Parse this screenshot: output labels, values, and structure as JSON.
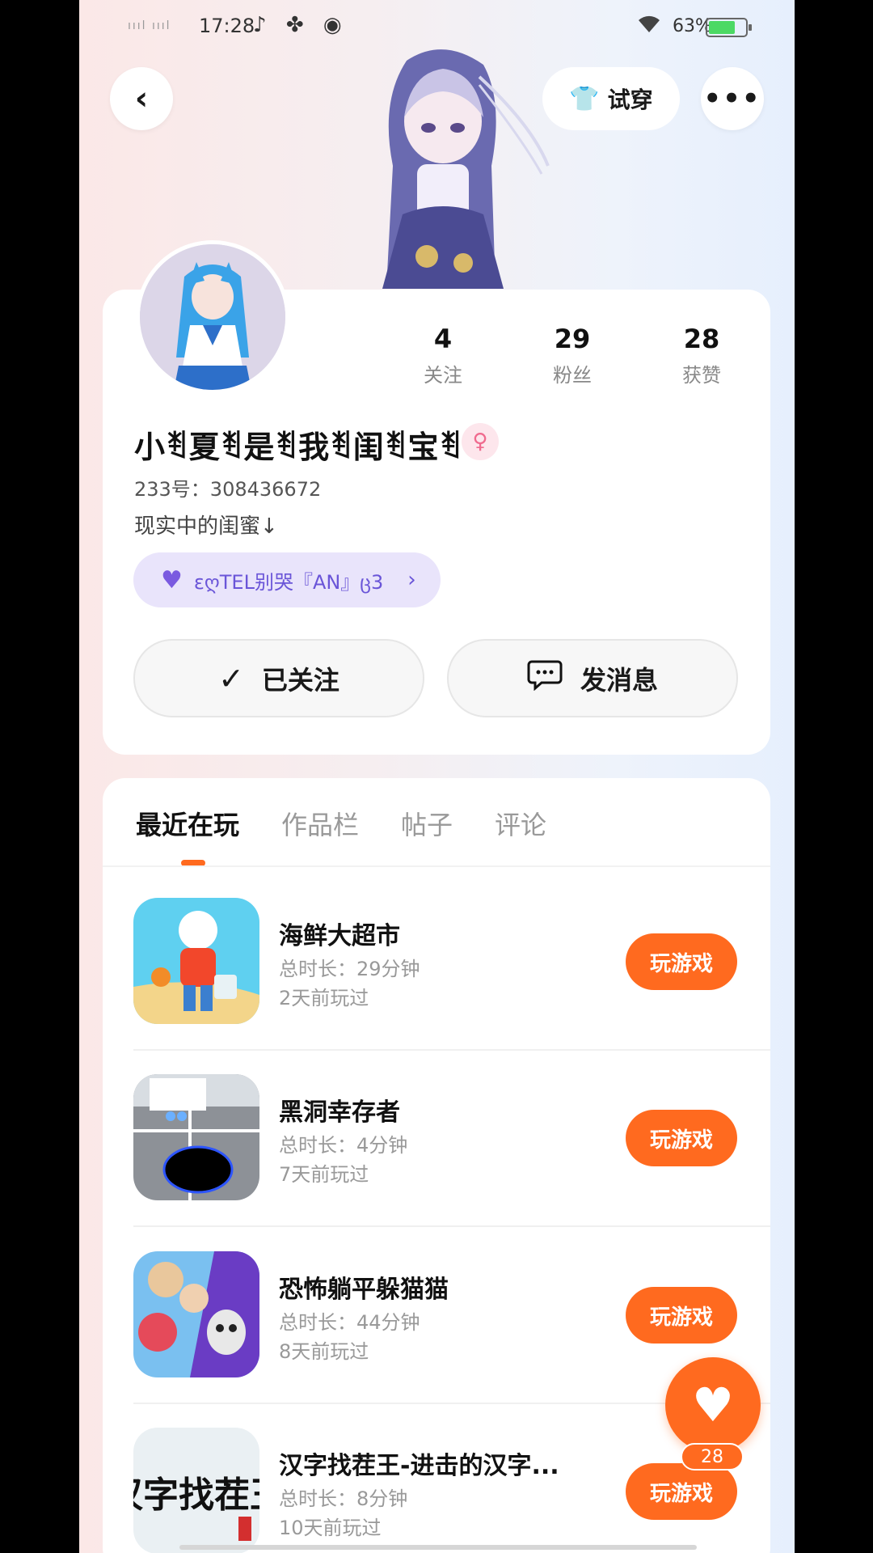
{
  "status_bar": {
    "signal": "ıııl ıııl",
    "time": "17:28",
    "app_icons": "♪ ✤ ◉",
    "wifi_icon": "wifi-icon",
    "battery": "63%"
  },
  "header": {
    "tryon_label": "试穿"
  },
  "profile": {
    "stats": [
      {
        "value": "4",
        "label": "关注"
      },
      {
        "value": "29",
        "label": "粉丝"
      },
      {
        "value": "28",
        "label": "获赞"
      }
    ],
    "nickname": "小ꄮ夏ꄮ是ꄮ我ꄮ闺ꄮ宝ꄮ",
    "gender_symbol": "♀",
    "uid": "233号：308436672",
    "bio": "现实中的闺蜜↓",
    "cp_tag": "εღTEL别哭『AN』ც3",
    "follow_label": "已关注",
    "message_label": "发消息"
  },
  "tabs": [
    "最近在玩",
    "作品栏",
    "帖子",
    "评论"
  ],
  "games": [
    {
      "title": "海鲜大超市",
      "duration": "总时长：29分钟",
      "last_played": "2天前玩过",
      "play_label": "玩游戏"
    },
    {
      "title": "黑洞幸存者",
      "duration": "总时长：4分钟",
      "last_played": "7天前玩过",
      "play_label": "玩游戏"
    },
    {
      "title": "恐怖躺平躲猫猫",
      "duration": "总时长：44分钟",
      "last_played": "8天前玩过",
      "play_label": "玩游戏"
    },
    {
      "title": "汉字找茬王-进击的汉字...",
      "duration": "总时长：8分钟",
      "last_played": "10天前玩过",
      "play_label": "玩游戏"
    }
  ],
  "game4_icon_text": "汉字找茬王",
  "fab": {
    "count": "28"
  },
  "colors": {
    "accent": "#ff6a1f",
    "cp_bg": "#e9e4fb",
    "cp_text": "#6a55d8",
    "gender": "#f06a8e"
  }
}
